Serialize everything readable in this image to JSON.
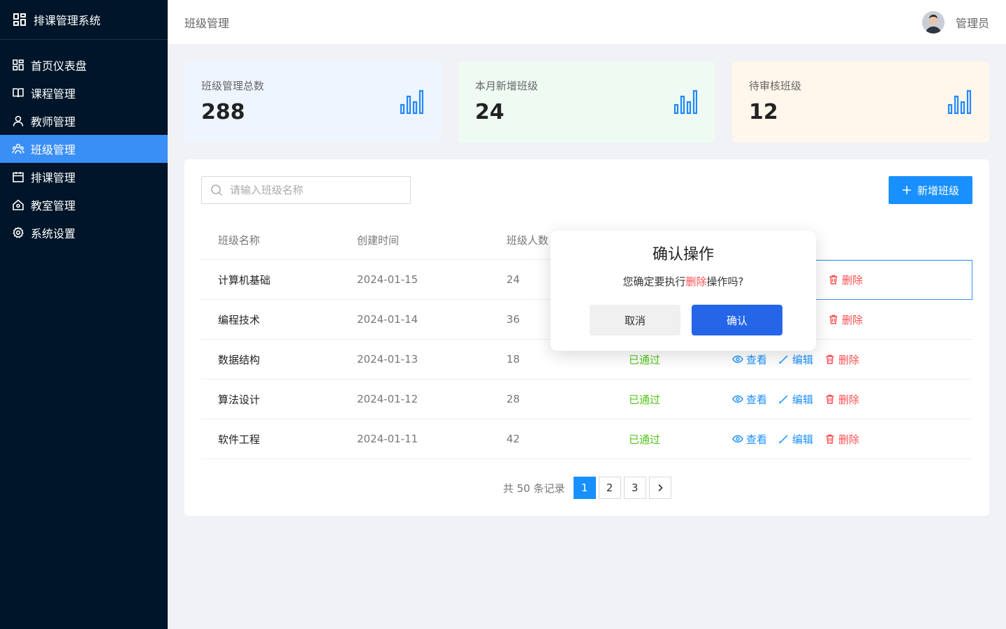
{
  "app": {
    "title": "排课管理系统"
  },
  "sidebar": {
    "items": [
      {
        "label": "首页仪表盘",
        "icon": "dashboard-icon"
      },
      {
        "label": "课程管理",
        "icon": "book-icon"
      },
      {
        "label": "教师管理",
        "icon": "user-icon"
      },
      {
        "label": "班级管理",
        "icon": "team-icon",
        "active": true
      },
      {
        "label": "排课管理",
        "icon": "calendar-icon"
      },
      {
        "label": "教室管理",
        "icon": "home-icon"
      },
      {
        "label": "系统设置",
        "icon": "gear-icon"
      }
    ]
  },
  "header": {
    "breadcrumb": "班级管理",
    "username": "管理员"
  },
  "stats": [
    {
      "label": "班级管理总数",
      "value": "288",
      "bg": "#eef5ff"
    },
    {
      "label": "本月新增班级",
      "value": "24",
      "bg": "#effbf2"
    },
    {
      "label": "待审核班级",
      "value": "12",
      "bg": "#fff6ec"
    }
  ],
  "toolbar": {
    "search_placeholder": "请输入班级名称",
    "add_label": "新增班级"
  },
  "table": {
    "columns": [
      "班级名称",
      "创建时间",
      "班级人数"
    ],
    "rows": [
      {
        "name": "计算机基础",
        "date": "2024-01-15",
        "count": "24",
        "status": ""
      },
      {
        "name": "编程技术",
        "date": "2024-01-14",
        "count": "36",
        "status": ""
      },
      {
        "name": "数据结构",
        "date": "2024-01-13",
        "count": "18",
        "status": "已通过"
      },
      {
        "name": "算法设计",
        "date": "2024-01-12",
        "count": "28",
        "status": "已通过"
      },
      {
        "name": "软件工程",
        "date": "2024-01-11",
        "count": "42",
        "status": "已通过"
      }
    ],
    "actions": {
      "view": "查看",
      "edit": "编辑",
      "delete": "删除"
    }
  },
  "pagination": {
    "total_text": "共 50 条记录",
    "pages": [
      "1",
      "2",
      "3"
    ],
    "current": "1"
  },
  "modal": {
    "title": "确认操作",
    "body_prefix": "您确定要执行",
    "body_action": "删除",
    "body_suffix": "操作吗?",
    "cancel_label": "取消",
    "ok_label": "确认"
  },
  "colors": {
    "sidebar_bg": "#001529",
    "active": "#3a8ff7",
    "primary": "#1890ff",
    "danger": "#ff4d4f",
    "success": "#52c41a"
  }
}
